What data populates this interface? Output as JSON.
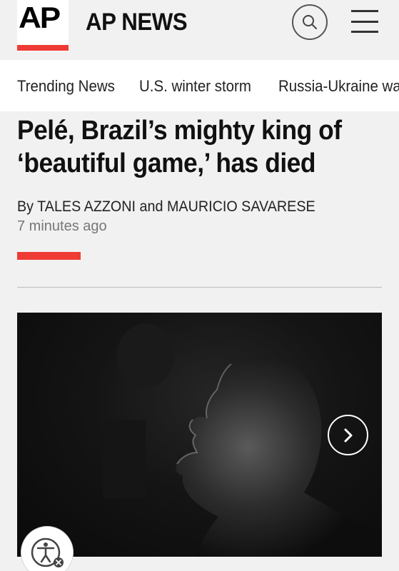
{
  "header": {
    "logo_text": "AP",
    "brand_name": "AP NEWS",
    "search_icon": "search-icon",
    "menu_icon": "hamburger-menu-icon",
    "accent_color": "#ef3b35"
  },
  "trending": {
    "items": [
      {
        "label": "Trending News"
      },
      {
        "label": "U.S. winter storm"
      },
      {
        "label": "Russia-Ukraine wa"
      }
    ]
  },
  "article": {
    "headline": "Pelé, Brazil’s mighty king of ‘beautiful game,’ has died",
    "byline_prefix": "By",
    "author_1": "TALES AZZONI",
    "byline_joiner": "and",
    "author_2": "MAURICIO SAVARESE",
    "timestamp": "7 minutes ago"
  },
  "gallery": {
    "next_icon": "chevron-right-icon"
  },
  "accessibility": {
    "icon": "accessibility-icon"
  }
}
